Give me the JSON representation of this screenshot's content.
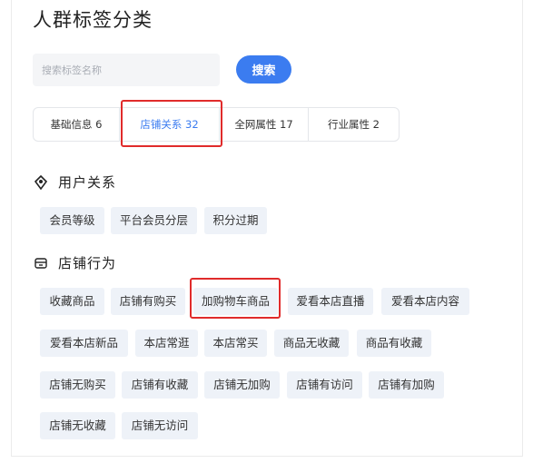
{
  "title": "人群标签分类",
  "search": {
    "placeholder": "搜索标签名称",
    "button_label": "搜索"
  },
  "tabs": [
    {
      "label": "基础信息 6",
      "active": false
    },
    {
      "label": "店铺关系 32",
      "active": true
    },
    {
      "label": "全网属性 17",
      "active": false
    },
    {
      "label": "行业属性 2",
      "active": false
    }
  ],
  "sections": [
    {
      "label": "用户关系",
      "icon": "diamond-user-icon",
      "tags": [
        "会员等级",
        "平台会员分层",
        "积分过期"
      ]
    },
    {
      "label": "店铺行为",
      "icon": "store-icon",
      "tags": [
        "收藏商品",
        "店铺有购买",
        "加购物车商品",
        "爱看本店直播",
        "爱看本店内容",
        "爱看本店新品",
        "本店常逛",
        "本店常买",
        "商品无收藏",
        "商品有收藏",
        "店铺无购买",
        "店铺有收藏",
        "店铺无加购",
        "店铺有访问",
        "店铺有加购",
        "店铺无收藏",
        "店铺无访问"
      ]
    }
  ],
  "colors": {
    "accent": "#3b7cf0",
    "highlight": "#e02b2b",
    "chip_bg": "#eef2f8"
  }
}
